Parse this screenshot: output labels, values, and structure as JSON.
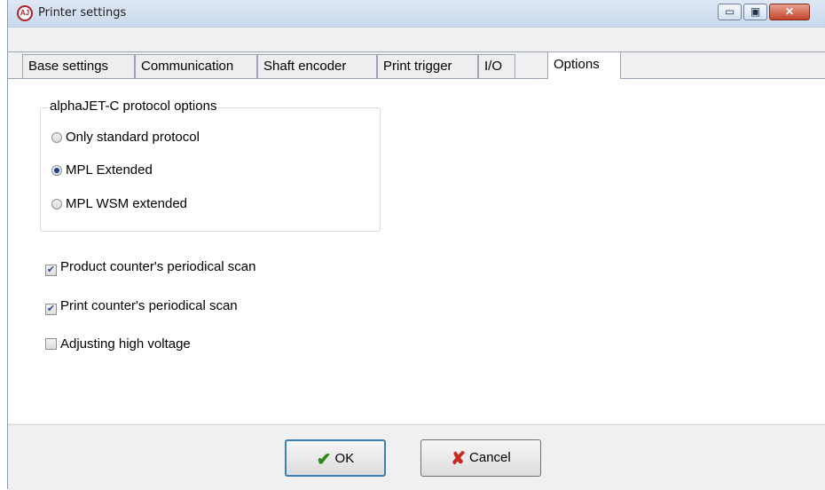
{
  "window": {
    "title": "Printer settings",
    "minimize_glyph": "▭",
    "maximize_glyph": "▣",
    "close_glyph": "✕"
  },
  "tabs": [
    {
      "label": "Base settings",
      "active": false
    },
    {
      "label": "Communication",
      "active": false
    },
    {
      "label": "Shaft encoder",
      "active": false
    },
    {
      "label": "Print trigger",
      "active": false
    },
    {
      "label": "I/O",
      "active": false
    },
    {
      "label": "Options",
      "active": true
    }
  ],
  "protocol_group": {
    "legend": "alphaJET-C protocol options",
    "options": [
      {
        "label": "Only standard protocol",
        "selected": false
      },
      {
        "label": "MPL Extended",
        "selected": true
      },
      {
        "label": "MPL WSM extended",
        "selected": false
      }
    ]
  },
  "checkboxes": [
    {
      "label": "Product counter's periodical scan",
      "checked": true
    },
    {
      "label": "Print counter's periodical scan",
      "checked": true
    },
    {
      "label": "Adjusting high voltage",
      "checked": false
    }
  ],
  "buttons": {
    "ok_label": "OK",
    "cancel_label": "Cancel"
  },
  "icons": {
    "app": "app-logo-icon",
    "ok": "check-icon",
    "cancel": "cross-icon"
  },
  "colors": {
    "title_bar": "#c9d8ec",
    "close_button": "#c5432b",
    "ok_check": "#2f8a19",
    "cancel_x": "#c8281e"
  }
}
